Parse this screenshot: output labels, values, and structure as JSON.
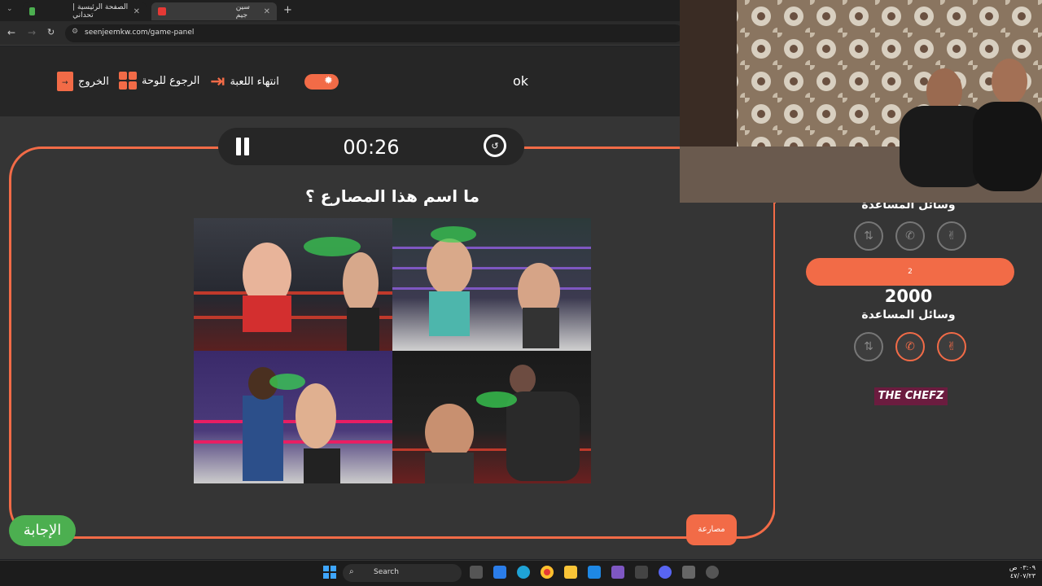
{
  "browser": {
    "tabs": [
      {
        "title": "الصفحة الرئيسية | تحداني",
        "active": false
      },
      {
        "title": "سين جيم",
        "active": true
      }
    ],
    "url": "seenjeemkw.com/game-panel"
  },
  "topbar": {
    "exit_label": "الخروج",
    "back_to_board_label": "الرجوع للوحة",
    "end_game_label": "انتهاء اللعبة",
    "status_text": "ok"
  },
  "timer": {
    "time": "00:26"
  },
  "question": {
    "text": "ما اسم هذا المصارع ؟"
  },
  "teams": [
    {
      "name": "",
      "score": "",
      "aids_label": "وسائل المساعدة"
    },
    {
      "name": "2",
      "score": "2000",
      "aids_label": "وسائل المساعدة"
    }
  ],
  "sponsor": {
    "logo_text": "THE CHEFZ"
  },
  "buttons": {
    "answer_label": "الإجابة",
    "category_label": "مصارعة"
  },
  "taskbar": {
    "search_placeholder": "Search",
    "time": "٠٣:٠٩ ص",
    "date": "٤٧/٠٧/٢٣"
  },
  "colors": {
    "accent": "#f26b47",
    "answer": "#4caf50",
    "panel": "#353535"
  }
}
